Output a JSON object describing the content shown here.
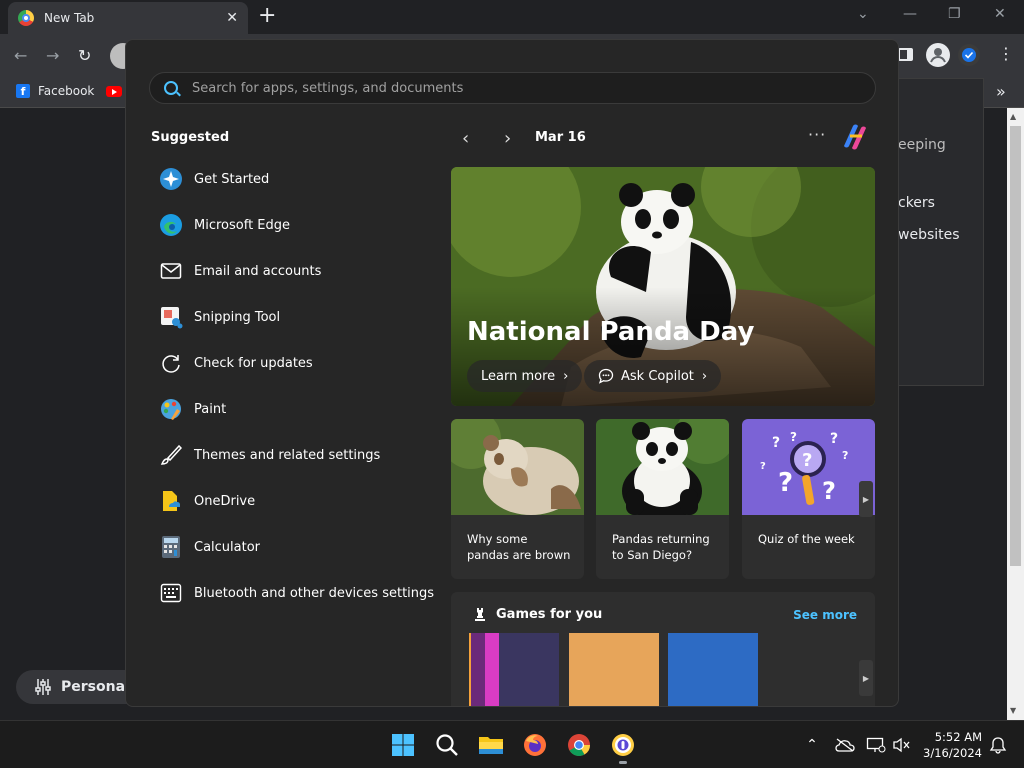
{
  "browser": {
    "tab_title": "New Tab",
    "tab_close": "✕",
    "new_tab": "+",
    "bookmarks": [
      {
        "label": "Facebook",
        "icon": "facebook-icon"
      },
      {
        "label": "",
        "icon": "youtube-icon"
      }
    ],
    "bookmarks_more": "»"
  },
  "background_page": {
    "fragments": [
      "eeping",
      "ckers",
      "websites"
    ],
    "personalize_label": "Personali"
  },
  "start_menu": {
    "search_placeholder": "Search for apps, settings, and documents",
    "suggested_title": "Suggested",
    "apps": [
      {
        "label": "Get Started",
        "icon": "get-started-icon"
      },
      {
        "label": "Microsoft Edge",
        "icon": "edge-icon"
      },
      {
        "label": "Email and accounts",
        "icon": "mail-icon"
      },
      {
        "label": "Snipping Tool",
        "icon": "snipping-tool-icon"
      },
      {
        "label": "Check for updates",
        "icon": "refresh-icon"
      },
      {
        "label": "Paint",
        "icon": "paint-icon"
      },
      {
        "label": "Themes and related settings",
        "icon": "brush-icon"
      },
      {
        "label": "OneDrive",
        "icon": "onedrive-icon"
      },
      {
        "label": "Calculator",
        "icon": "calculator-icon"
      },
      {
        "label": "Bluetooth and other devices settings",
        "icon": "keyboard-icon"
      }
    ],
    "widgets": {
      "date": "Mar 16",
      "hero_title": "National Panda Day",
      "learn_more": "Learn more",
      "ask_copilot": "Ask Copilot",
      "cards": [
        {
          "caption": "Why some pandas are brown"
        },
        {
          "caption": "Pandas returning to San Diego?"
        },
        {
          "caption": "Quiz of the week"
        }
      ],
      "games_title": "Games for you",
      "see_more": "See more"
    }
  },
  "taskbar": {
    "time": "5:52 AM",
    "date": "3/16/2024"
  },
  "colors": {
    "accent": "#4cc2ff",
    "start_bg": "#262626"
  }
}
